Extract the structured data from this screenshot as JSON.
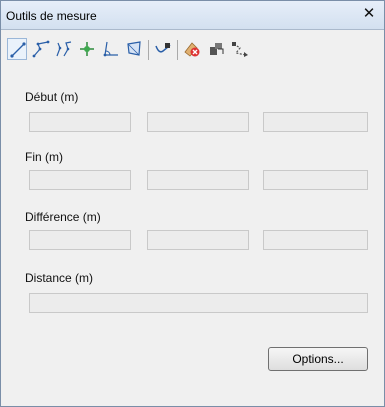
{
  "window": {
    "title": "Outils de mesure",
    "close_glyph": "✕"
  },
  "toolbar": {
    "tools": [
      {
        "icon": "measure-line-icon",
        "active": true
      },
      {
        "icon": "measure-polyline-icon"
      },
      {
        "icon": "measure-multi-line-icon"
      },
      {
        "icon": "measure-point-icon"
      },
      {
        "icon": "measure-angle-icon"
      },
      {
        "icon": "measure-area-icon"
      },
      {
        "icon": "profile-path-icon"
      },
      {
        "icon": "clear-measure-icon"
      },
      {
        "icon": "export-measure-icon"
      },
      {
        "icon": "measure-route-icon"
      }
    ]
  },
  "sections": {
    "start": {
      "label": "Début (m)",
      "values": [
        "",
        "",
        ""
      ]
    },
    "end": {
      "label": "Fin (m)",
      "values": [
        "",
        "",
        ""
      ]
    },
    "difference": {
      "label": "Différence (m)",
      "values": [
        "",
        "",
        ""
      ]
    },
    "distance": {
      "label": "Distance (m)",
      "value": ""
    }
  },
  "options_button": {
    "label": "Options..."
  },
  "colors": {
    "titlebar": "#dbe6f4",
    "panel": "#f0f0f0",
    "field_bg": "#ececec",
    "field_border": "#c9c9c9"
  }
}
